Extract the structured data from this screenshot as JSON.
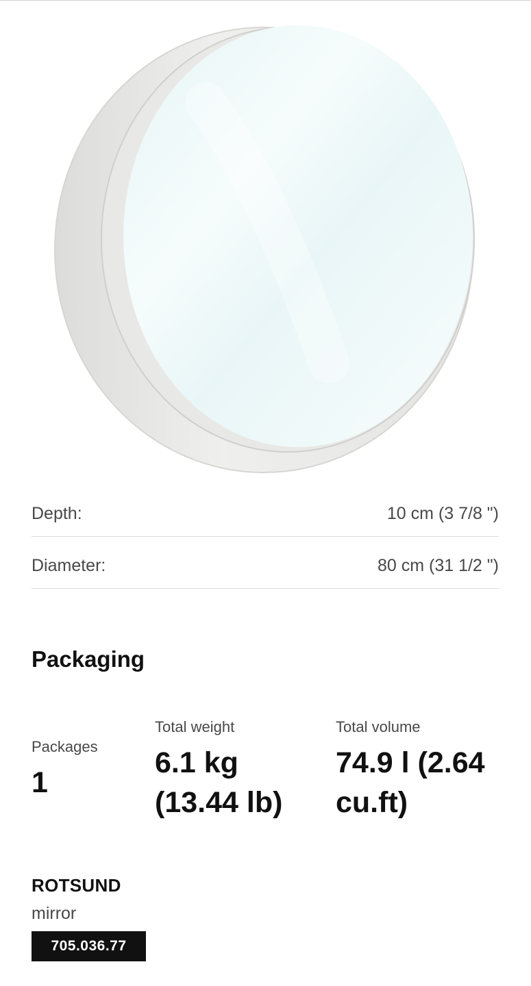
{
  "product_image": {
    "alt": "ROTSUND mirror"
  },
  "dimensions": [
    {
      "label": "Depth:",
      "value": "10 cm (3 7/8 \")"
    },
    {
      "label": "Diameter:",
      "value": "80 cm (31 1/2 \")"
    }
  ],
  "packaging": {
    "title": "Packaging",
    "packages_label": "Packages",
    "packages_value": "1",
    "weight_label": "Total weight",
    "weight_value_line1": "6.1 kg",
    "weight_value_line2": "(13.44 lb)",
    "volume_label": "Total volume",
    "volume_value_line1": "74.9 l (2.64",
    "volume_value_line2": "cu.ft)"
  },
  "product": {
    "name": "ROTSUND",
    "type": "mirror",
    "article_number": "705.036.77"
  },
  "colors": {
    "frame": "#ebebea",
    "glass": "#f3fbfb",
    "divider": "#dcdcdc",
    "article_bg": "#111111"
  }
}
